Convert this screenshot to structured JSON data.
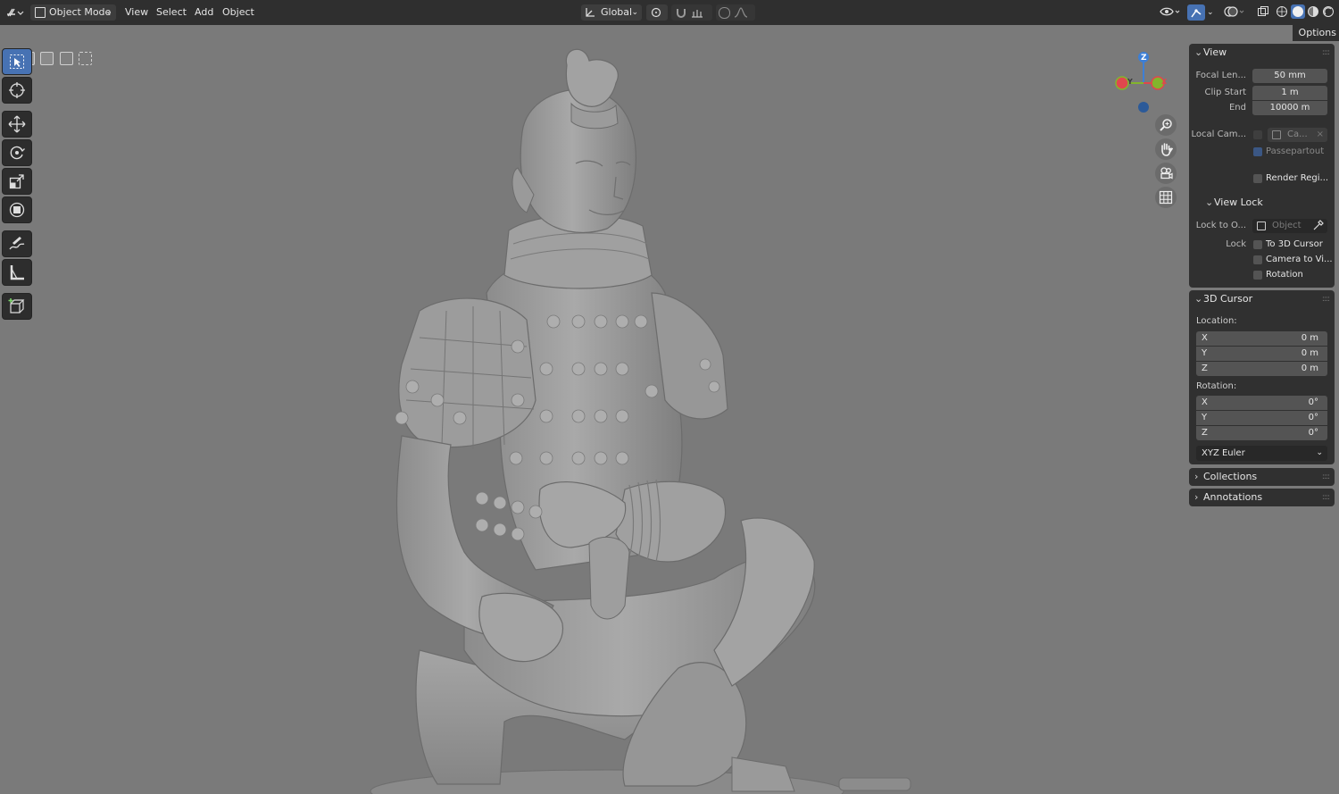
{
  "header": {
    "mode_label": "Object Mode",
    "menus": [
      "View",
      "Select",
      "Add",
      "Object"
    ],
    "orientation_label": "Global"
  },
  "options_label": "Options",
  "gizmo": {
    "z": "Z",
    "y": "Y",
    "x": "X"
  },
  "npanel": {
    "view": {
      "title": "View",
      "focal_label": "Focal Len...",
      "focal_value": "50 mm",
      "clip_start_label": "Clip Start",
      "clip_start_value": "1 m",
      "end_label": "End",
      "end_value": "10000 m",
      "local_cam_label": "Local Cam...",
      "local_cam_value": "Ca...",
      "passepartout_label": "Passepartout",
      "render_region_label": "Render Regi...",
      "view_lock_title": "View Lock",
      "lock_to_label": "Lock to O...",
      "lock_to_placeholder": "Object",
      "lock_label": "Lock",
      "to_3d_cursor_label": "To 3D Cursor",
      "camera_to_view_label": "Camera to Vi...",
      "rotation_label": "Rotation"
    },
    "cursor": {
      "title": "3D Cursor",
      "location_label": "Location:",
      "location": [
        {
          "axis": "X",
          "value": "0 m"
        },
        {
          "axis": "Y",
          "value": "0 m"
        },
        {
          "axis": "Z",
          "value": "0 m"
        }
      ],
      "rotation_label": "Rotation:",
      "rotation": [
        {
          "axis": "X",
          "value": "0°"
        },
        {
          "axis": "Y",
          "value": "0°"
        },
        {
          "axis": "Z",
          "value": "0°"
        }
      ],
      "mode_value": "XYZ Euler"
    },
    "collections_title": "Collections",
    "annotations_title": "Annotations"
  },
  "colors": {
    "accent": "#4772b3",
    "x_axis": "#e0474d",
    "y_axis": "#83b52c",
    "z_axis": "#3d7fd6"
  }
}
